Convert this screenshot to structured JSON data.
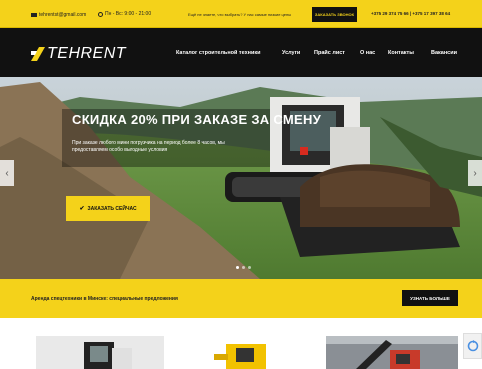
{
  "topbar": {
    "email": "tehrentst@gmail.com",
    "hours": "Пн - Вс: 9:00 - 21:00",
    "question": "Ещё не знаете, что выбрать? У нас самые низкие цены",
    "call_button": "ЗАКАЗАТЬ ЗВОНОК",
    "phones": "+375 29 374 75 66 | +375 17 397 38 64"
  },
  "logo": {
    "text": "TEHRENT"
  },
  "nav": {
    "items": [
      "Каталог строительной техники",
      "Услуги",
      "Прайс лист",
      "О нас",
      "Контакты",
      "Вакансии"
    ]
  },
  "hero": {
    "title": "СКИДКА 20% ПРИ ЗАКАЗЕ ЗА СМЕНУ",
    "description": "При заказе любого мини погрузчика на период более 8 часов, мы предоставляем особо выгодные условия",
    "cta": "ЗАКАЗАТЬ СЕЙЧАС",
    "arrow_left": "‹",
    "arrow_right": "›"
  },
  "promo": {
    "text": "Аренда спецтехники в Минске: специальные предложения",
    "button": "УЗНАТЬ БОЛЬШЕ"
  },
  "colors": {
    "accent": "#f4d21a",
    "dark": "#111111"
  },
  "icons": [
    "envelope-icon",
    "clock-icon",
    "check-icon",
    "recaptcha-icon"
  ]
}
